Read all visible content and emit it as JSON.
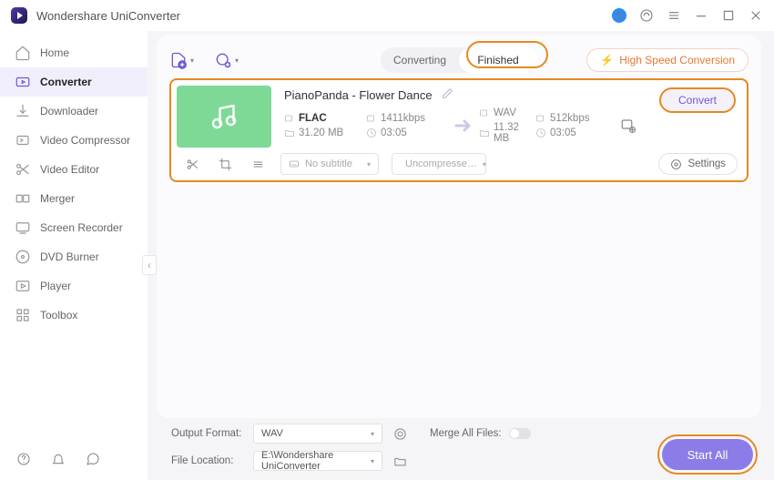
{
  "app": {
    "name": "Wondershare UniConverter"
  },
  "sidebar": {
    "items": [
      {
        "label": "Home",
        "icon": "home"
      },
      {
        "label": "Converter",
        "icon": "convert"
      },
      {
        "label": "Downloader",
        "icon": "download"
      },
      {
        "label": "Video Compressor",
        "icon": "compress"
      },
      {
        "label": "Video Editor",
        "icon": "cut"
      },
      {
        "label": "Merger",
        "icon": "merge"
      },
      {
        "label": "Screen Recorder",
        "icon": "record"
      },
      {
        "label": "DVD Burner",
        "icon": "disc"
      },
      {
        "label": "Player",
        "icon": "play"
      },
      {
        "label": "Toolbox",
        "icon": "grid"
      }
    ]
  },
  "toolbar": {
    "tabs": [
      "Converting",
      "Finished"
    ],
    "active_tab": "Finished",
    "hs_label": "High Speed Conversion"
  },
  "file": {
    "title": "PianoPanda - Flower Dance",
    "source": {
      "format": "FLAC",
      "bitrate": "1411kbps",
      "size": "31.20 MB",
      "duration": "03:05"
    },
    "target": {
      "format": "WAV",
      "bitrate": "512kbps",
      "size": "11.32 MB",
      "duration": "03:05"
    },
    "subtitle": "No subtitle",
    "audio": "Uncompresse…",
    "settings_label": "Settings",
    "convert_label": "Convert"
  },
  "bottom": {
    "output_format_label": "Output Format:",
    "output_format_value": "WAV",
    "file_location_label": "File Location:",
    "file_location_value": "E:\\Wondershare UniConverter",
    "merge_label": "Merge All Files:",
    "start_all_label": "Start All"
  }
}
